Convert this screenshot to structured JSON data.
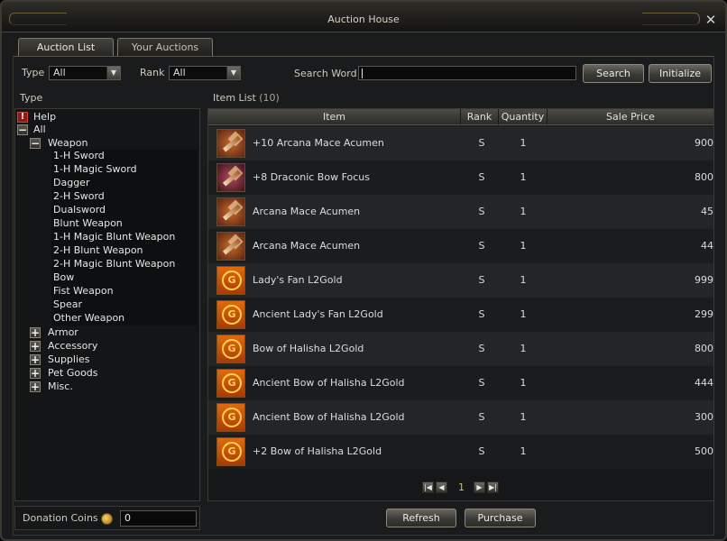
{
  "window": {
    "title": "Auction House"
  },
  "tabs": [
    {
      "label": "Auction List"
    },
    {
      "label": "Your Auctions"
    }
  ],
  "filters": {
    "type_label": "Type",
    "type_value": "All",
    "rank_label": "Rank",
    "rank_value": "All",
    "search_label": "Search Word",
    "search_value": "",
    "search_button": "Search",
    "initialize_button": "Initialize"
  },
  "tree": {
    "title": "Type",
    "help": "Help",
    "all": "All",
    "weapon": "Weapon",
    "weapon_items": [
      "1-H Sword",
      "1-H Magic Sword",
      "Dagger",
      "2-H Sword",
      "Dualsword",
      "Blunt Weapon",
      "1-H Magic Blunt Weapon",
      "2-H Blunt Weapon",
      "2-H Magic Blunt Weapon",
      "Bow",
      "Fist Weapon",
      "Spear",
      "Other Weapon"
    ],
    "categories": [
      "Armor",
      "Accessory",
      "Supplies",
      "Pet Goods",
      "Misc."
    ]
  },
  "item_list": {
    "title": "Item List",
    "count": "(10)",
    "headers": {
      "item": "Item",
      "rank": "Rank",
      "quantity": "Quantity",
      "price": "Sale Price"
    },
    "items": [
      {
        "name": "+10 Arcana Mace Acumen",
        "rank": "S",
        "quantity": "1",
        "price": "900",
        "icon": "mace-icon"
      },
      {
        "name": "+8 Draconic Bow Focus",
        "rank": "S",
        "quantity": "1",
        "price": "800",
        "icon": "bow-icon"
      },
      {
        "name": "Arcana Mace Acumen",
        "rank": "S",
        "quantity": "1",
        "price": "45",
        "icon": "mace-icon"
      },
      {
        "name": "Arcana Mace Acumen",
        "rank": "S",
        "quantity": "1",
        "price": "44",
        "icon": "mace-icon"
      },
      {
        "name": "Lady's Fan L2Gold",
        "rank": "S",
        "quantity": "1",
        "price": "999",
        "icon": "l2gold-icon"
      },
      {
        "name": "Ancient Lady's Fan L2Gold",
        "rank": "S",
        "quantity": "1",
        "price": "299",
        "icon": "l2gold-icon"
      },
      {
        "name": "Bow of Halisha L2Gold",
        "rank": "S",
        "quantity": "1",
        "price": "800",
        "icon": "l2gold-icon"
      },
      {
        "name": "Ancient Bow of Halisha L2Gold",
        "rank": "S",
        "quantity": "1",
        "price": "444",
        "icon": "l2gold-icon"
      },
      {
        "name": "Ancient Bow of Halisha L2Gold",
        "rank": "S",
        "quantity": "1",
        "price": "300",
        "icon": "l2gold-icon"
      },
      {
        "name": "+2 Bow of Halisha L2Gold",
        "rank": "S",
        "quantity": "1",
        "price": "500",
        "icon": "l2gold-icon"
      }
    ]
  },
  "pager": {
    "page": "1"
  },
  "footer": {
    "donation_label": "Donation Coins",
    "donation_value": "0",
    "refresh_button": "Refresh",
    "purchase_button": "Purchase"
  }
}
